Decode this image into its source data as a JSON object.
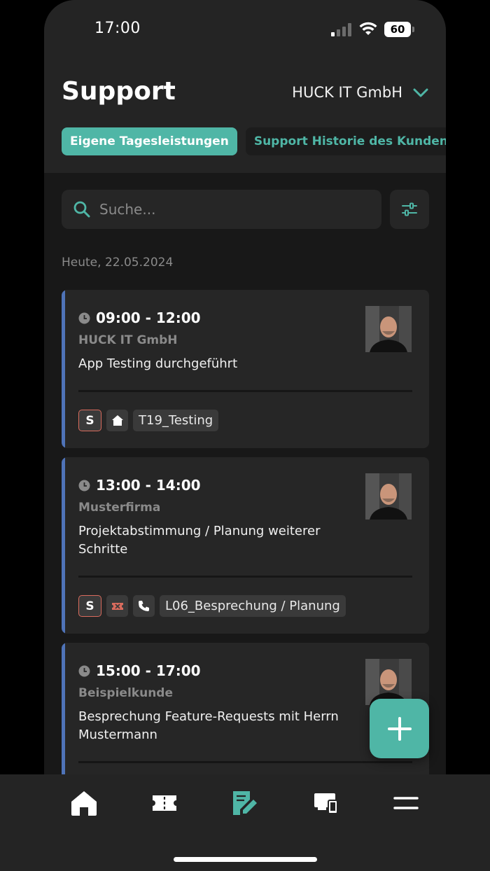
{
  "status_bar": {
    "time": "17:00",
    "battery": "60"
  },
  "header": {
    "title": "Support",
    "company": "HUCK IT GmbH"
  },
  "tabs": [
    {
      "label": "Eigene Tagesleistungen",
      "active": true
    },
    {
      "label": "Support Historie des Kunden",
      "active": false
    }
  ],
  "search": {
    "placeholder": "Suche..."
  },
  "date_label": "Heute, 22.05.2024",
  "entries": [
    {
      "time": "09:00 - 12:00",
      "customer": "HUCK IT GmbH",
      "description": "App Testing durchgeführt",
      "chip_s": "S",
      "tag": "T19_Testing"
    },
    {
      "time": "13:00 - 14:00",
      "customer": "Musterfirma",
      "description": "Projektabstimmung / Planung weiterer Schritte",
      "chip_s": "S",
      "tag": "L06_Besprechung / Planung"
    },
    {
      "time": "15:00 - 17:00",
      "customer": "Beispielkunde",
      "description": "Besprechung Feature-Requests mit Herrn Mustermann"
    }
  ],
  "colors": {
    "accent": "#4fb6a6",
    "card_bar": "#4f73b8",
    "chip_border": "#d96b5d",
    "background": "#181818"
  },
  "nav": [
    {
      "icon": "home-icon"
    },
    {
      "icon": "ticket-icon"
    },
    {
      "icon": "edit-document-icon",
      "active": true
    },
    {
      "icon": "devices-icon"
    },
    {
      "icon": "menu-icon"
    }
  ]
}
